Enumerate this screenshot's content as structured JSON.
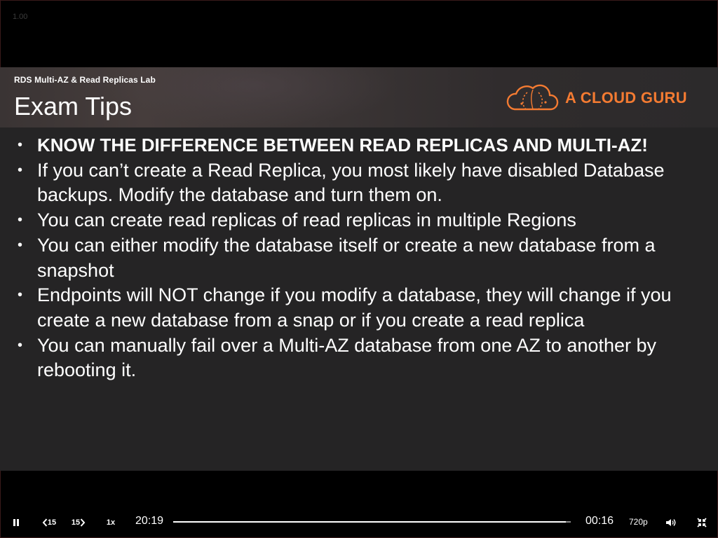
{
  "player": {
    "speed_overlay": "1.00",
    "controls": {
      "rewind_label": "15",
      "forward_label": "15",
      "speed_label": "1x",
      "elapsed_time": "20:19",
      "remaining_time": "00:16",
      "quality_label": "720p",
      "progress_fraction": 0.987,
      "icons": {
        "pause": "pause-icon",
        "rewind": "rewind-15-icon",
        "forward": "forward-15-icon",
        "volume": "volume-icon",
        "exit_fullscreen": "exit-fullscreen-icon"
      }
    }
  },
  "slide": {
    "subtitle": "RDS Multi-AZ & Read Replicas Lab",
    "title": "Exam Tips",
    "brand": {
      "name": "A CLOUD GURU",
      "color": "#f47b32",
      "logo_icon": "cloud-guru-logo-icon"
    },
    "bullet_glyph": "•",
    "tips": [
      "KNOW THE DIFFERENCE BETWEEN READ REPLICAS AND MULTI-AZ!",
      "If you can’t create a Read Replica, you most likely have disabled Database backups. Modify the database and turn them on.",
      "You can create read replicas of read replicas in multiple Regions",
      "You can either modify the database itself or create a new database from a snapshot",
      "Endpoints will NOT change if you modify a database, they will change if you create a new database from a snap or if you create a read replica",
      "You can manually fail over a Multi-AZ database from one AZ to another by rebooting it."
    ]
  }
}
